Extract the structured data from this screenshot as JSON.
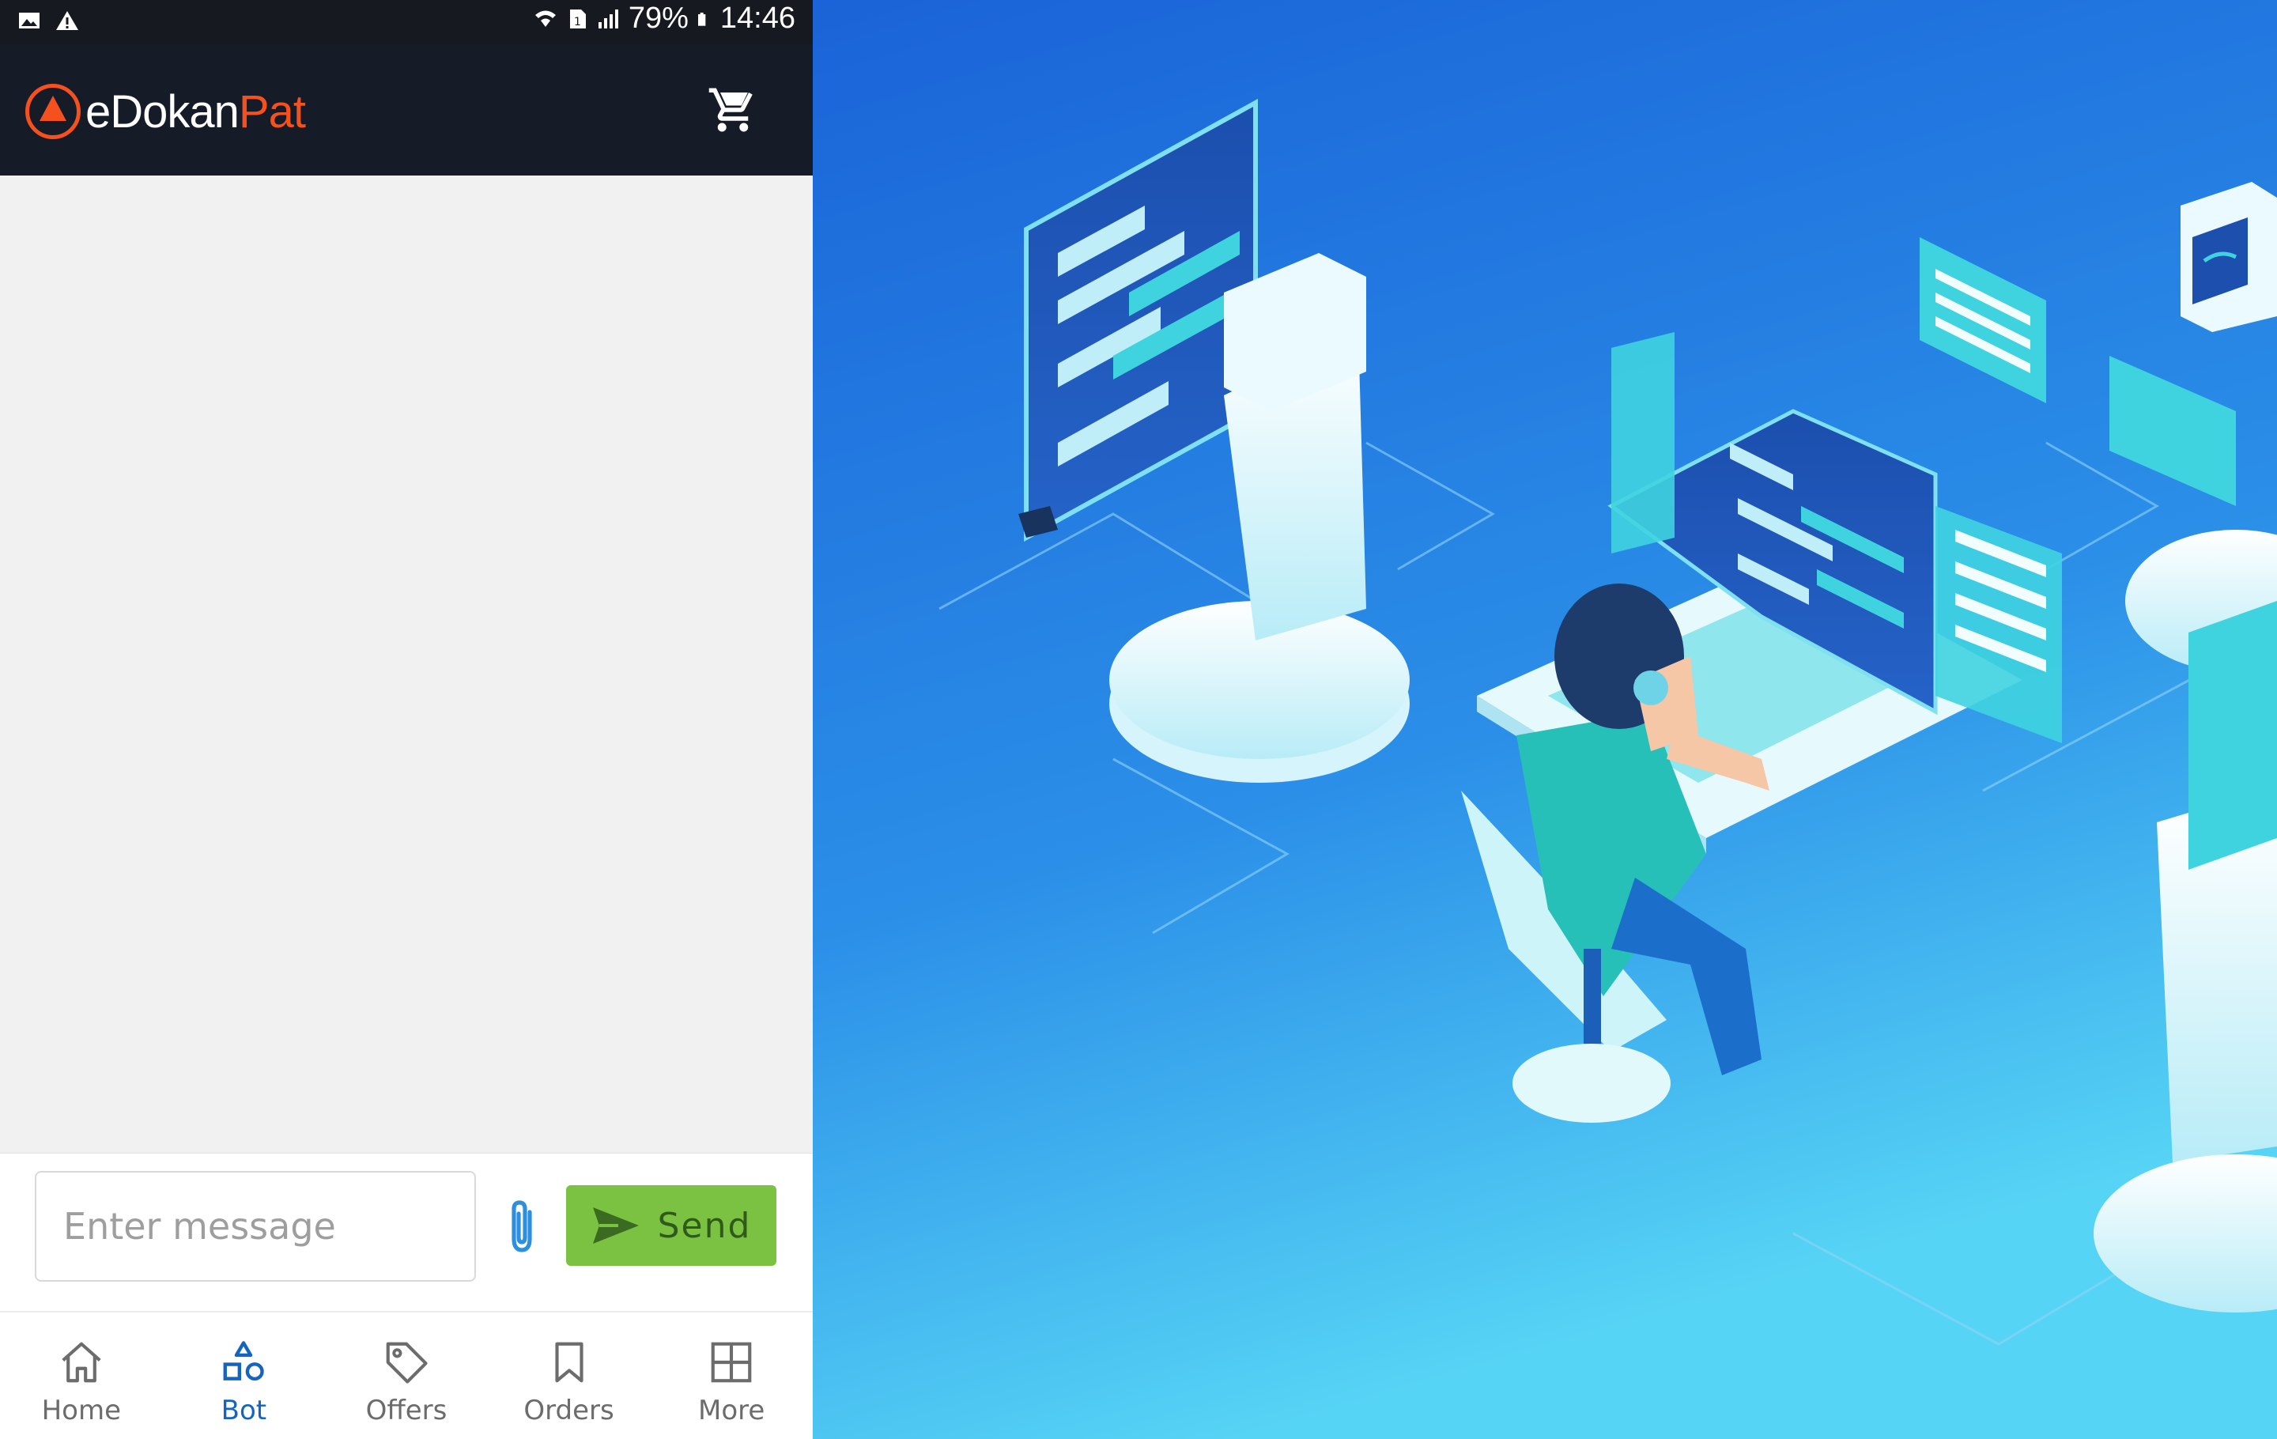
{
  "status_bar": {
    "battery": "79%",
    "time": "14:46",
    "left_icons": [
      "gallery-icon",
      "warning-icon"
    ],
    "right_icons": [
      "wifi-icon",
      "sim-icon",
      "signal-icon"
    ]
  },
  "app": {
    "logo_text_primary": "eDokan",
    "logo_text_accent": "Pat",
    "cart_icon": "cart-icon"
  },
  "composer": {
    "placeholder": "Enter message",
    "value": "",
    "send_label": "Send"
  },
  "tabs": [
    {
      "label": "Home",
      "icon": "home-icon",
      "active": false
    },
    {
      "label": "Bot",
      "icon": "shapes-icon",
      "active": true
    },
    {
      "label": "Offers",
      "icon": "tag-icon",
      "active": false
    },
    {
      "label": "Orders",
      "icon": "bookmark-icon",
      "active": false
    },
    {
      "label": "More",
      "icon": "grid-icon",
      "active": false
    }
  ],
  "colors": {
    "appbar": "#161b28",
    "accent": "#f4511e",
    "send_button": "#7cc242",
    "active_tab": "#1565c0",
    "illustration_bg": "#1f73dc"
  }
}
